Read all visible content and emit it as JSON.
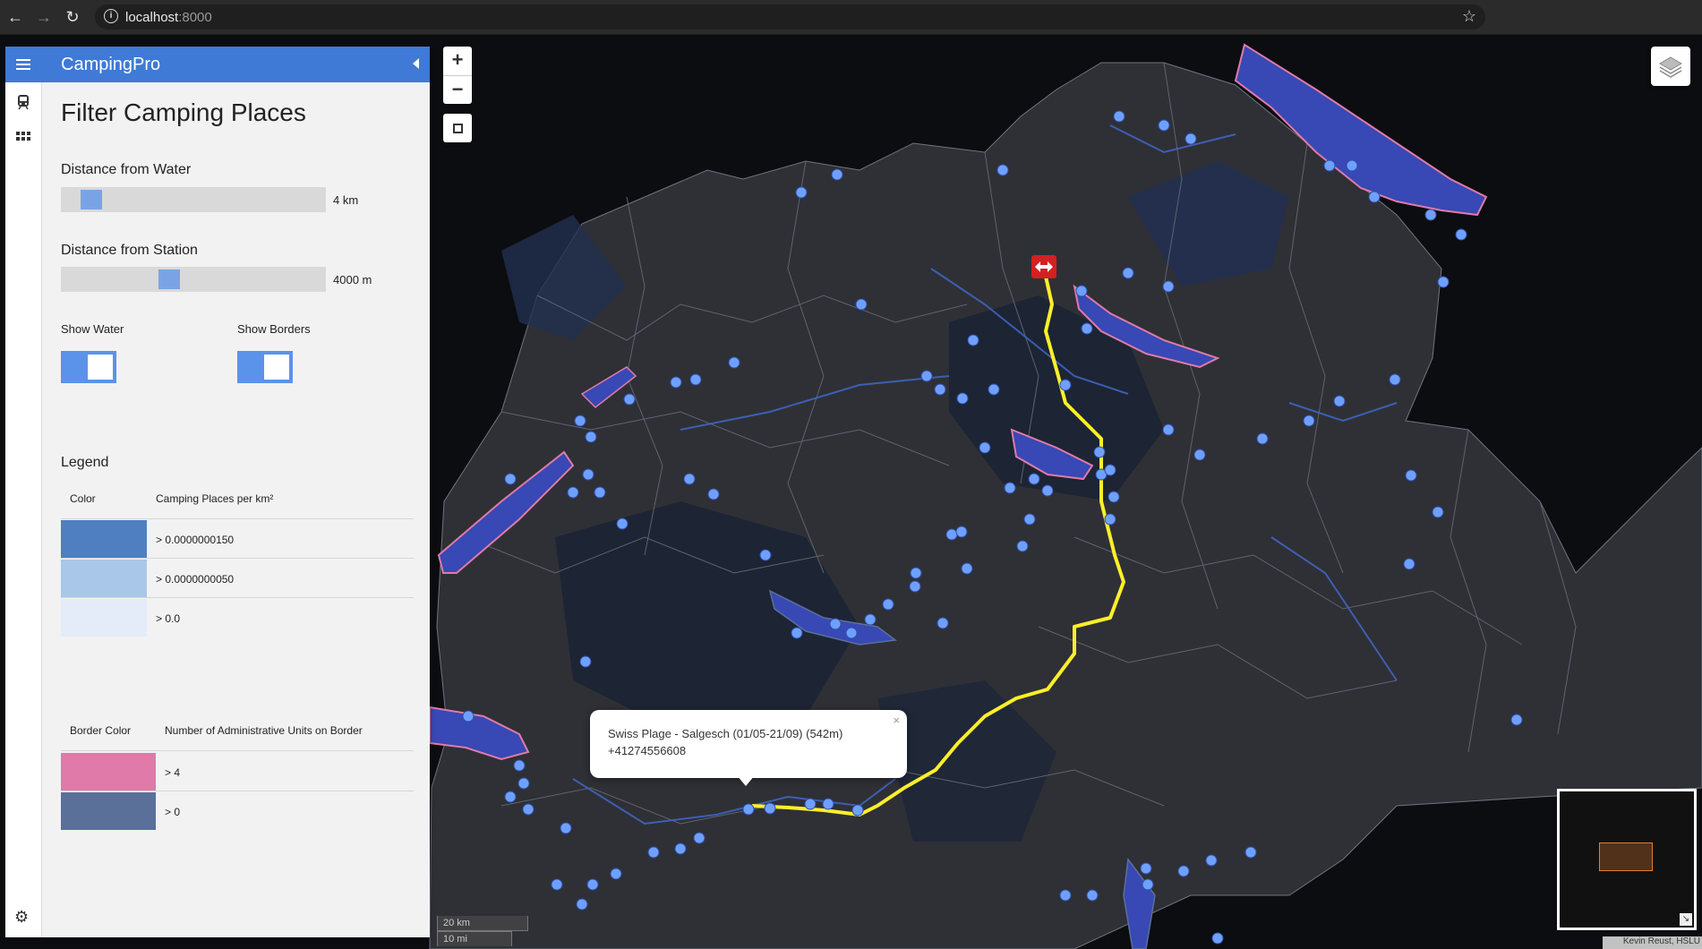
{
  "browser": {
    "url_host": "localhost",
    "url_port": ":8000",
    "icons": [
      "back-icon",
      "forward-icon",
      "reload-icon",
      "info-icon",
      "star-icon"
    ]
  },
  "sidebar": {
    "app_title": "CampingPro",
    "panel_title": "Filter Camping Places",
    "tabs": [
      "train-icon",
      "grid-icon"
    ],
    "settings_icon": "gear-icon",
    "water_slider": {
      "label": "Distance from Water",
      "value": "4 km",
      "fraction": 0.08
    },
    "station_slider": {
      "label": "Distance from Station",
      "value": "4000 m",
      "fraction": 0.4
    },
    "show_water": {
      "label": "Show Water",
      "on": true
    },
    "show_borders": {
      "label": "Show Borders",
      "on": true
    },
    "legend": {
      "title": "Legend",
      "color_header": "Color",
      "density_header": "Camping Places per km²",
      "density_rows": [
        {
          "color": "#4f7fc0",
          "label": "> 0.0000000150"
        },
        {
          "color": "#a9c7e8",
          "label": "> 0.0000000050"
        },
        {
          "color": "#e4ecf9",
          "label": "> 0.0"
        }
      ],
      "border_header": "Border Color",
      "units_header": "Number of Administrative Units on Border",
      "border_rows": [
        {
          "color": "#e07aa8",
          "label": "> 4"
        },
        {
          "color": "#5a7099",
          "label": "> 0"
        }
      ]
    }
  },
  "map": {
    "zoom_in": "+",
    "zoom_out": "−",
    "popup": {
      "line1": "Swiss Plage - Salgesch (01/05-21/09) (542m)",
      "line2": "+41274556608",
      "close": "×"
    },
    "scale_km": "20 km",
    "scale_mi": "10 mi",
    "attribution": "Kevin Reust, HSLU",
    "colors": {
      "route": "#ffef2a",
      "border_pink": "#e07aa8",
      "water": "#3a4fb8",
      "camp": "#6fa0ff"
    }
  }
}
